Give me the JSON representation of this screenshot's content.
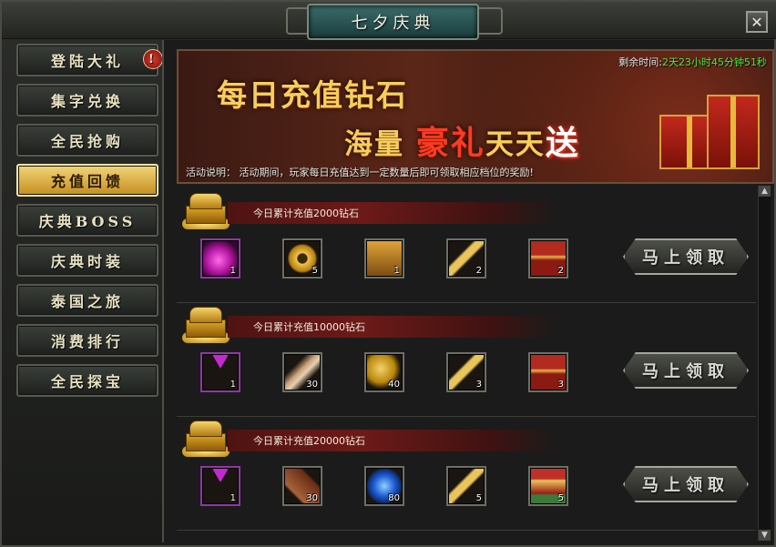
{
  "window": {
    "title": "七夕庆典",
    "close": "✕"
  },
  "sidebar": {
    "alert": "!",
    "items": [
      {
        "label": "登陆大礼"
      },
      {
        "label": "集字兑换"
      },
      {
        "label": "全民抢购"
      },
      {
        "label": "充值回馈"
      },
      {
        "label": "庆典BOSS"
      },
      {
        "label": "庆典时装"
      },
      {
        "label": "泰国之旅"
      },
      {
        "label": "消费排行"
      },
      {
        "label": "全民探宝"
      }
    ],
    "active_index": 3
  },
  "banner": {
    "timer_label": "剩余时间:",
    "timer_value": "2天23小时45分钟51秒",
    "line1": "每日充值钻石",
    "line2_a": "海量",
    "line2_b": "豪礼",
    "line2_c": "天天",
    "line2_d": "送",
    "description": "活动说明： 活动期间，玩家每日充值达到一定数量后即可领取相应档位的奖励!"
  },
  "tiers": [
    {
      "label": "今日累计充值2000钻石",
      "button": "马上领取",
      "items": [
        {
          "icon": "pink-gem-icon",
          "count": "1"
        },
        {
          "icon": "gold-ring-icon",
          "count": "5"
        },
        {
          "icon": "treasure-chest-icon",
          "count": "1"
        },
        {
          "icon": "golden-key-icon",
          "count": "2"
        },
        {
          "icon": "red-treasure-box-icon",
          "count": "2"
        }
      ]
    },
    {
      "label": "今日累计充值10000钻石",
      "button": "马上领取",
      "items": [
        {
          "icon": "purple-crystal-icon",
          "count": "1"
        },
        {
          "icon": "feather-icon",
          "count": "30"
        },
        {
          "icon": "golden-wing-icon",
          "count": "40"
        },
        {
          "icon": "golden-key-icon",
          "count": "3"
        },
        {
          "icon": "red-treasure-box-icon",
          "count": "3"
        }
      ]
    },
    {
      "label": "今日累计充值20000钻石",
      "button": "马上领取",
      "items": [
        {
          "icon": "purple-crystal-icon",
          "count": "1"
        },
        {
          "icon": "scroll-book-icon",
          "count": "30"
        },
        {
          "icon": "blue-crystal-icon",
          "count": "80"
        },
        {
          "icon": "golden-key-icon",
          "count": "5"
        },
        {
          "icon": "ornate-chest-icon",
          "count": "5"
        }
      ]
    }
  ]
}
